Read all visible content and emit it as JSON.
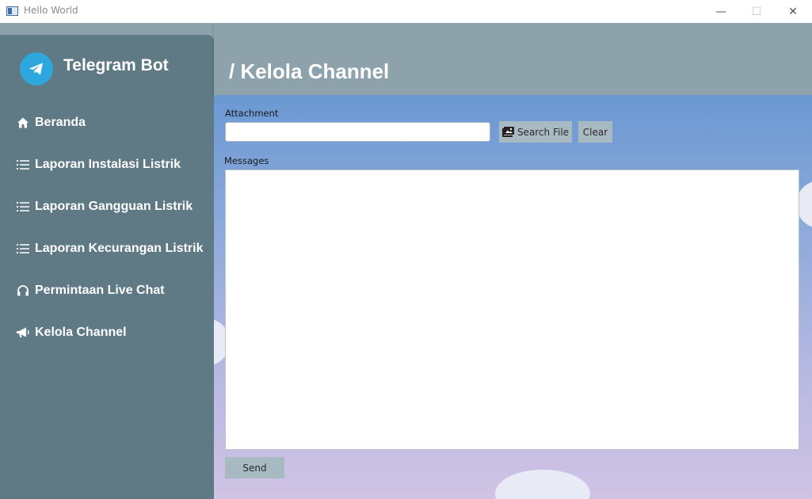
{
  "window": {
    "title": "Hello World",
    "minimize_glyph": "—",
    "maximize_glyph": "☐",
    "close_glyph": "✕"
  },
  "sidebar": {
    "brand": "Telegram Bot",
    "brand_icon": "telegram-icon",
    "items": [
      {
        "label": "Beranda",
        "icon": "home-icon"
      },
      {
        "label": "Laporan Instalasi Listrik",
        "icon": "list-icon"
      },
      {
        "label": "Laporan Gangguan Listrik",
        "icon": "list-icon"
      },
      {
        "label": "Laporan Kecurangan Listrik",
        "icon": "list-icon"
      },
      {
        "label": "Permintaan Live Chat",
        "icon": "headset-icon"
      },
      {
        "label": "Kelola Channel",
        "icon": "megaphone-icon"
      }
    ]
  },
  "header": {
    "title": "/ Kelola Channel"
  },
  "form": {
    "attachment_label": "Attachment",
    "attachment_value": "",
    "search_button": "Search File",
    "clear_button": "Clear",
    "messages_label": "Messages",
    "messages_value": "",
    "send_button": "Send"
  },
  "colors": {
    "sidebar": "#5f7985",
    "header": "#8ea2ab",
    "telegram_blue": "#2ea6de",
    "button": "#a9b9c1"
  }
}
